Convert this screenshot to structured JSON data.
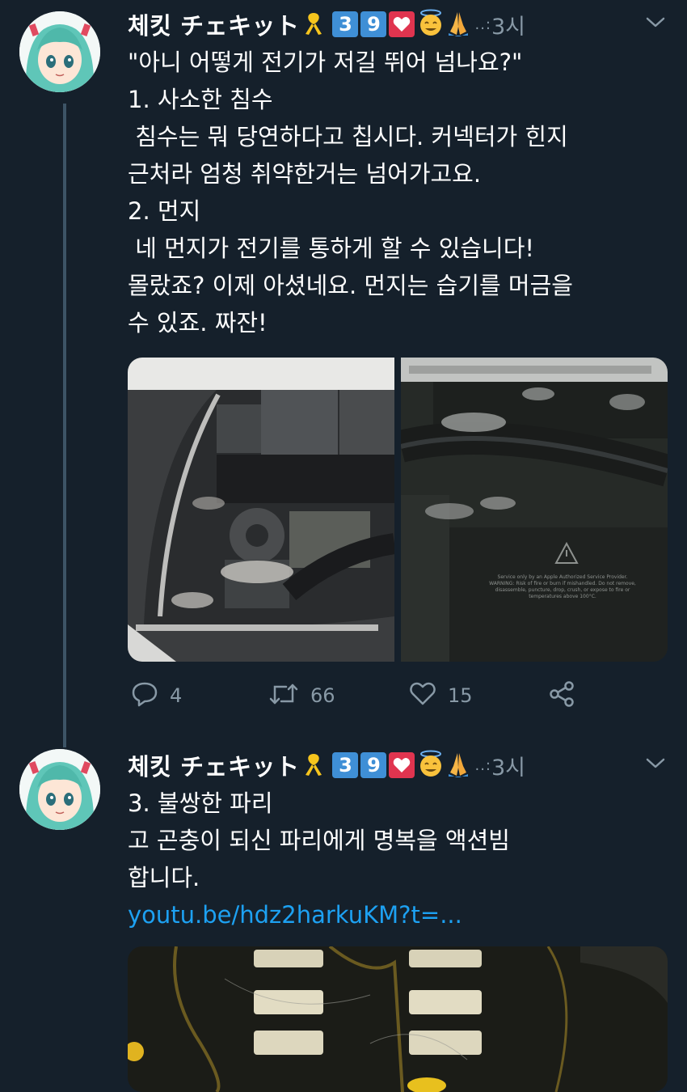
{
  "tweets": [
    {
      "name": "체킷 チェキット",
      "badge1": "3",
      "badge2": "9",
      "handle": "..:",
      "time": "3시",
      "lines": [
        "\"아니 어떻게 전기가 저길 뛰어 넘나요?\"",
        "1. 사소한 침수",
        " 침수는 뭐 당연하다고 칩시다. 커넥터가 힌지",
        "근처라 엄청 취약한거는 넘어가고요.",
        "2. 먼지",
        " 네 먼지가 전기를 통하게 할 수 있습니다!",
        "몰랐죠? 이제 아셨네요. 먼지는 습기를 머금을",
        "수 있죠. 짜잔!"
      ],
      "media_warning": [
        "Service only by an Apple Authorized Service Provider.",
        "WARNING: Risk of fire or burn if mishandled. Do not remove,",
        "disassemble, puncture, drop, crush, or expose to fire or",
        "temperatures above 100°C."
      ],
      "actions": {
        "replies": "4",
        "retweets": "66",
        "likes": "15"
      }
    },
    {
      "name": "체킷 チェキット",
      "badge1": "3",
      "badge2": "9",
      "handle": "..:",
      "time": "3시",
      "lines": [
        "3. 불쌍한 파리",
        "고 곤충이 되신 파리에게 명복을 액션빔",
        "합니다."
      ],
      "link": "youtu.be/hdz2harkuKM?t=..."
    }
  ]
}
